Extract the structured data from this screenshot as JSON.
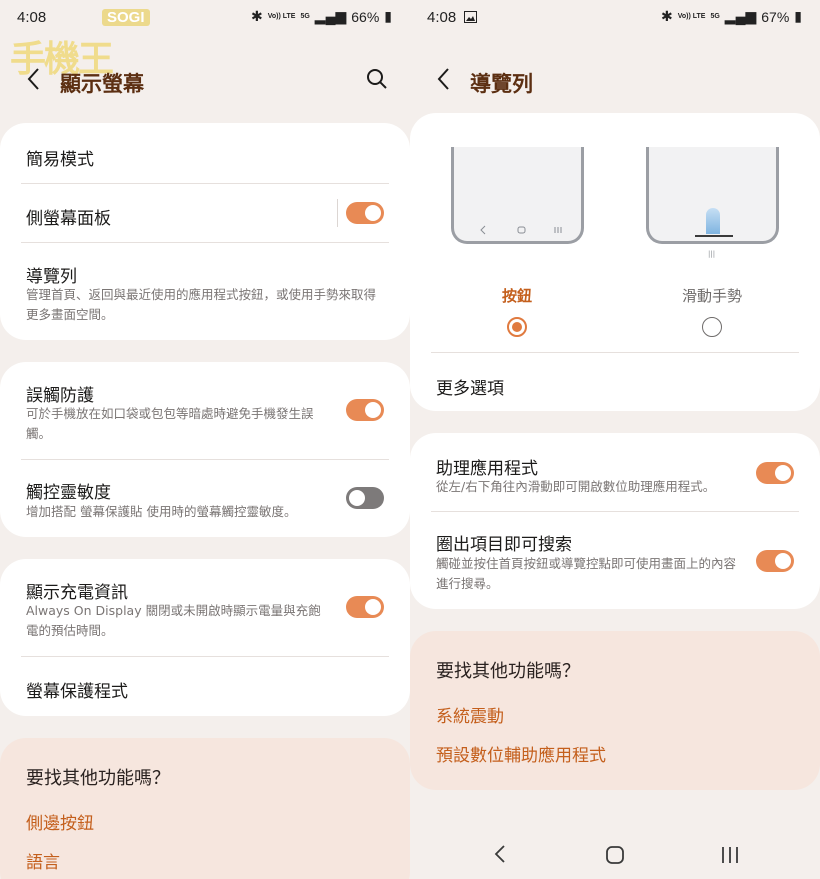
{
  "left": {
    "status": {
      "time": "4:08",
      "battery": "66%",
      "net": "5G",
      "volte": "Vo)) LTE"
    },
    "watermark": {
      "brand": "SOGI",
      "mark": "手機王"
    },
    "header": {
      "title": "顯示螢幕"
    },
    "card1": {
      "easy_mode": "簡易模式",
      "edge_panels": "側螢幕面板",
      "nav_bar": "導覽列",
      "nav_bar_desc": "管理首頁、返回與最近使用的應用程式按鈕，或使用手勢來取得更多畫面空間。"
    },
    "card2": {
      "accidental": "誤觸防護",
      "accidental_desc": "可於手機放在如口袋或包包等暗處時避免手機發生誤觸。",
      "sensitivity": "觸控靈敏度",
      "sensitivity_desc": "增加搭配 螢幕保護貼 使用時的螢幕觸控靈敏度。"
    },
    "card3": {
      "charging": "顯示充電資訊",
      "charging_desc": "Always On Display 關閉或未開啟時顯示電量與充飽電的預估時間。",
      "screensaver": "螢幕保護程式"
    },
    "tip": {
      "title": "要找其他功能嗎？",
      "link1": "側邊按鈕",
      "link2": "語言"
    },
    "toggles": {
      "edge_panels": true,
      "accidental": true,
      "sensitivity": false,
      "charging": true
    }
  },
  "right": {
    "status": {
      "time": "4:08",
      "battery": "67%",
      "net": "5G",
      "volte": "Vo)) LTE"
    },
    "header": {
      "title": "導覽列"
    },
    "options": {
      "buttons": "按鈕",
      "gestures": "滑動手勢",
      "selected": "buttons"
    },
    "more": "更多選項",
    "card2": {
      "assistant": "助理應用程式",
      "assistant_desc": "從左/右下角往內滑動即可開啟數位助理應用程式。",
      "circle": "圈出項目即可搜索",
      "circle_desc": "觸碰並按住首頁按鈕或導覽控點即可使用畫面上的內容進行搜尋。"
    },
    "tip": {
      "title": "要找其他功能嗎？",
      "link1": "系統震動",
      "link2": "預設數位輔助應用程式"
    },
    "toggles": {
      "assistant": true,
      "circle": true
    }
  },
  "colors": {
    "accent": "#e88a55",
    "link": "#c45f1c",
    "title_brown": "#5c2f12",
    "background": "#f4efec"
  }
}
